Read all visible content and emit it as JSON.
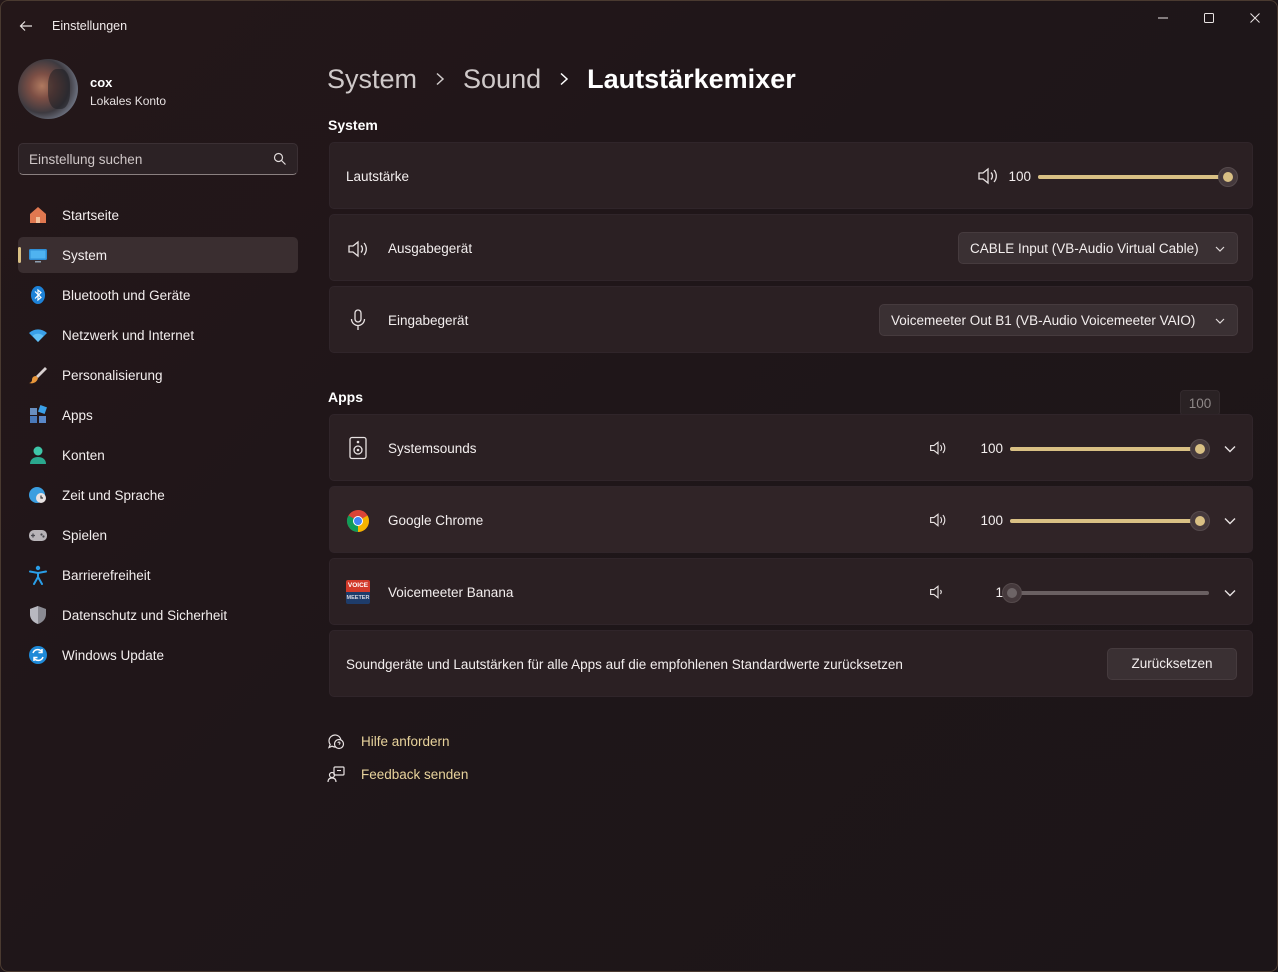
{
  "window": {
    "app_title": "Einstellungen"
  },
  "profile": {
    "name": "cox",
    "account_type": "Lokales Konto"
  },
  "search": {
    "placeholder": "Einstellung suchen"
  },
  "sidebar": {
    "items": [
      {
        "label": "Startseite",
        "icon": "home-icon",
        "selected": false
      },
      {
        "label": "System",
        "icon": "monitor-icon",
        "selected": true
      },
      {
        "label": "Bluetooth und Geräte",
        "icon": "bluetooth-icon",
        "selected": false
      },
      {
        "label": "Netzwerk und Internet",
        "icon": "wifi-icon",
        "selected": false
      },
      {
        "label": "Personalisierung",
        "icon": "brush-icon",
        "selected": false
      },
      {
        "label": "Apps",
        "icon": "apps-icon",
        "selected": false
      },
      {
        "label": "Konten",
        "icon": "person-icon",
        "selected": false
      },
      {
        "label": "Zeit und Sprache",
        "icon": "globe-clock-icon",
        "selected": false
      },
      {
        "label": "Spielen",
        "icon": "gamepad-icon",
        "selected": false
      },
      {
        "label": "Barrierefreiheit",
        "icon": "accessibility-icon",
        "selected": false
      },
      {
        "label": "Datenschutz und Sicherheit",
        "icon": "shield-icon",
        "selected": false
      },
      {
        "label": "Windows Update",
        "icon": "update-icon",
        "selected": false
      }
    ]
  },
  "breadcrumb": {
    "items": [
      "System",
      "Sound"
    ],
    "current": "Lautstärkemixer"
  },
  "system_section": {
    "title": "System",
    "volume": {
      "label": "Lautstärke",
      "value": "100",
      "level": 1.0
    },
    "output": {
      "label": "Ausgabegerät",
      "selected": "CABLE Input (VB-Audio Virtual Cable)"
    },
    "input": {
      "label": "Eingabegerät",
      "selected": "Voicemeeter Out B1 (VB-Audio Voicemeeter VAIO)"
    }
  },
  "apps_section": {
    "title": "Apps",
    "tooltip": "100",
    "apps": [
      {
        "name": "Systemsounds",
        "icon": "system-sounds-icon",
        "value": "100",
        "level": 1.0
      },
      {
        "name": "Google Chrome",
        "icon": "chrome-icon",
        "value": "100",
        "level": 1.0
      },
      {
        "name": "Voicemeeter Banana",
        "icon": "voicemeeter-icon",
        "icon_text_top": "VOICE",
        "icon_text_bottom": "MEETER",
        "value": "1",
        "level": 0.01
      }
    ]
  },
  "reset": {
    "text": "Soundgeräte und Lautstärken für alle Apps auf die empfohlenen Standardwerte zurücksetzen",
    "button": "Zurücksetzen"
  },
  "links": {
    "help": "Hilfe anfordern",
    "feedback": "Feedback senden"
  },
  "colors": {
    "accent": "#d9c084",
    "link": "#e8d39c",
    "background": "#211719"
  }
}
